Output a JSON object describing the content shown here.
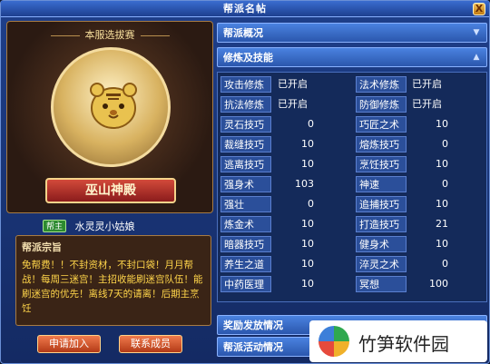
{
  "window": {
    "title": "帮派名帖",
    "close_label": "X"
  },
  "left": {
    "season_label": "本服选拔赛",
    "sect_name": "巫山神殿",
    "owner_badge": "帮主",
    "owner_name": "水灵灵小姑娘",
    "motto_title": "帮派宗旨",
    "motto_text": "免帮费！！不封资材，不封口袋！月月帮战！每周三迷宫！主招收能刷迷宫队伍！能刷迷宫的优先！离线7天的请离！后期主烹饪",
    "apply_button": "申请加入",
    "contact_button": "联系成员"
  },
  "right": {
    "overview_label": "帮派概况",
    "skills_label": "修炼及技能",
    "rewards_label": "奖励发放情况",
    "activity_label": "帮派活动情况",
    "skills": [
      {
        "name": "攻击修炼",
        "value": "已开启",
        "name2": "法术修炼",
        "value2": "已开启"
      },
      {
        "name": "抗法修炼",
        "value": "已开启",
        "name2": "防御修炼",
        "value2": "已开启"
      },
      {
        "name": "灵石技巧",
        "value": "0",
        "name2": "巧匠之术",
        "value2": "10"
      },
      {
        "name": "裁缝技巧",
        "value": "10",
        "name2": "熔炼技巧",
        "value2": "0"
      },
      {
        "name": "逃离技巧",
        "value": "10",
        "name2": "烹饪技巧",
        "value2": "10"
      },
      {
        "name": "强身术",
        "value": "103",
        "name2": "神速",
        "value2": "0"
      },
      {
        "name": "强壮",
        "value": "0",
        "name2": "追捕技巧",
        "value2": "10"
      },
      {
        "name": "炼金术",
        "value": "10",
        "name2": "打造技巧",
        "value2": "21"
      },
      {
        "name": "暗器技巧",
        "value": "10",
        "name2": "健身术",
        "value2": "10"
      },
      {
        "name": "养生之道",
        "value": "10",
        "name2": "淬灵之术",
        "value2": "0"
      },
      {
        "name": "中药医理",
        "value": "10",
        "name2": "冥想",
        "value2": "100"
      }
    ]
  },
  "watermark": {
    "text": "竹笋软件园"
  }
}
